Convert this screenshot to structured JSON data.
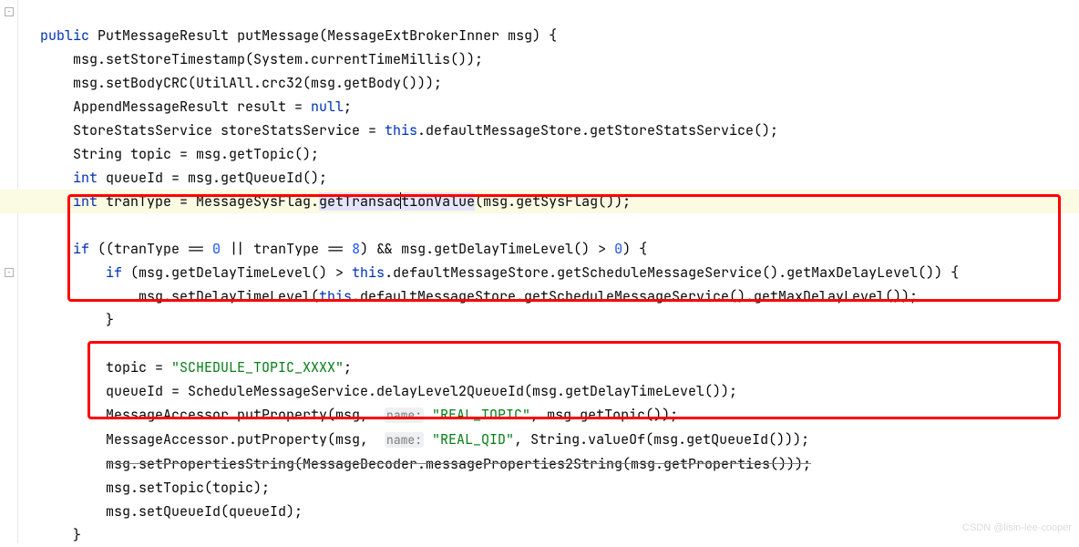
{
  "code": {
    "kw_public": "public",
    "type_PutMessageResult": "PutMessageResult",
    "method_name": "putMessage",
    "param_type": "MessageExtBrokerInner",
    "param_name": "msg",
    "l1": "msg.setStoreTimestamp(System.currentTimeMillis());",
    "l2": "msg.setBodyCRC(UtilAll.crc32(msg.getBody()));",
    "l3a": "AppendMessageResult result = ",
    "kw_null": "null",
    "l4a": "StoreStatsService storeStatsService = ",
    "kw_this": "this",
    "l4b": ".defaultMessageStore.getStoreStatsService();",
    "l5": "String topic = msg.getTopic();",
    "kw_int": "int",
    "l6": " queueId = msg.getQueueId();",
    "l7a": " tranType = MessageSysFlag.",
    "l7sel1": "getTransac",
    "l7sel2": "tionValue",
    "l7b": "(msg.getSysFlag());",
    "kw_if": "if",
    "l8a": " ((tranType == ",
    "num0": "0",
    "l8b": " || tranType == ",
    "num8": "8",
    "l8c": ") && msg.getDelayTimeLevel() > ",
    "l8d": ") {",
    "l9a": " (msg.getDelayTimeLevel() > ",
    "l9b": ".defaultMessageStore.getScheduleMessageService().getMaxDelayLevel()) {",
    "l10a": "msg.setDelayTimeLevel(",
    "l10b": ".defaultMessageStore.getScheduleMessageService().getMaxDelayLevel());",
    "l11": "}",
    "l12a": "topic = ",
    "str_schedule": "\"SCHEDULE_TOPIC_XXXX\"",
    "l13": "queueId = ScheduleMessageService.delayLevel2QueueId(msg.getDelayTimeLevel());",
    "l14a": "MessageAccessor.putProperty(msg,  ",
    "hint_name": "name:",
    "str_real_topic": " \"REAL_TOPIC\"",
    "l14b": ", msg.getTopic());",
    "str_real_qid": " \"REAL_QID\"",
    "l15b": ", String.valueOf(msg.getQueueId()));",
    "l16": "msg.setPropertiesString(MessageDecoder.messageProperties2String(msg.getProperties()));",
    "l17": "msg.setTopic(topic);",
    "l18": "msg.setQueueId(queueId);",
    "l19": "}"
  },
  "watermark": "CSDN @lisin-lee-cooper"
}
